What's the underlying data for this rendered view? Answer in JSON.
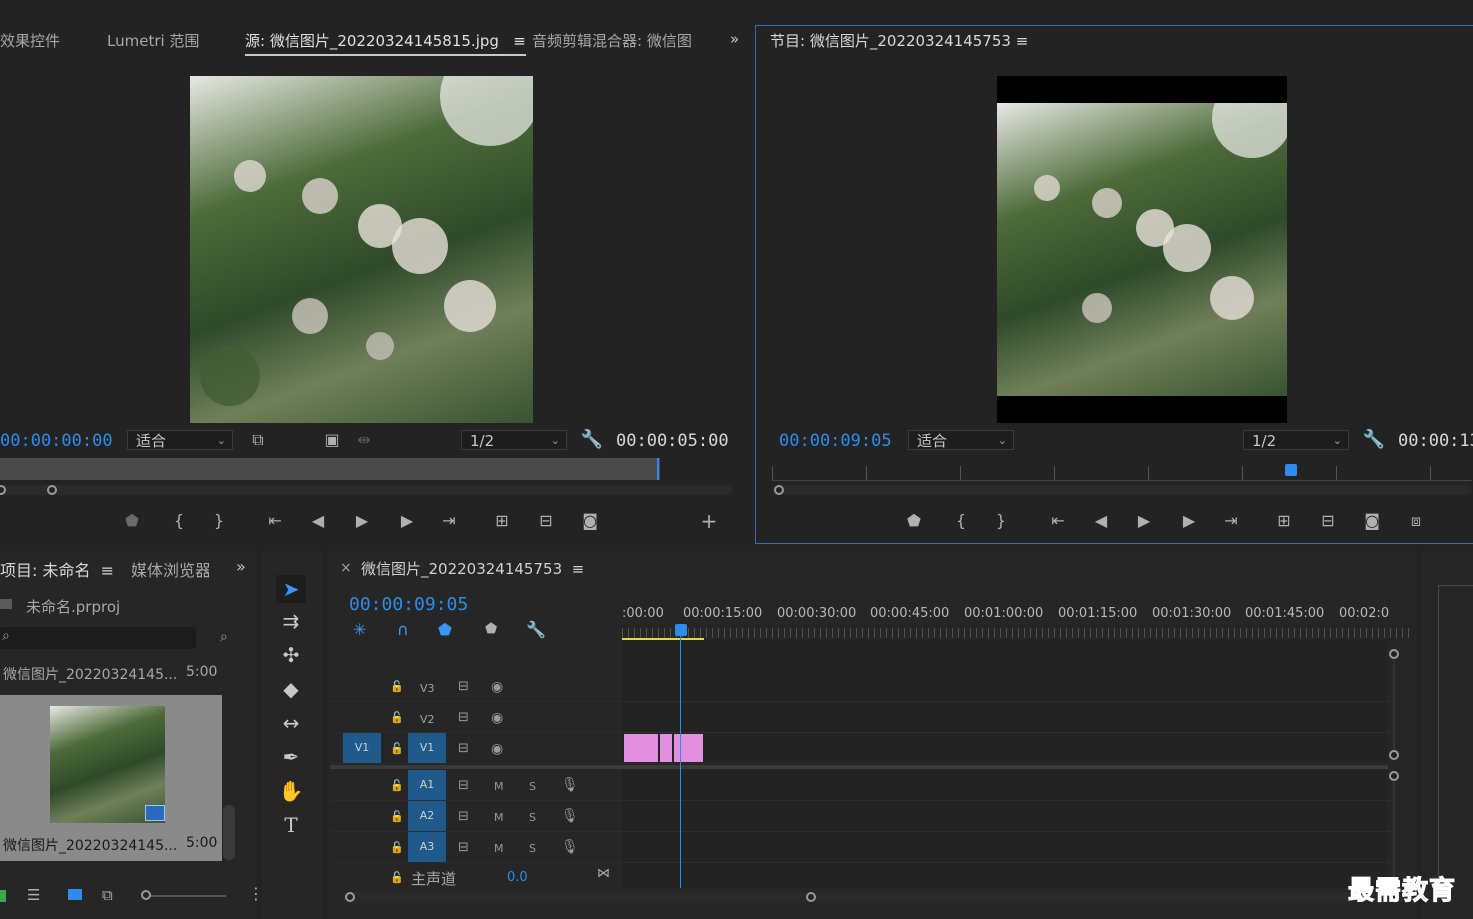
{
  "source_panel": {
    "tabs": [
      "效果控件",
      "Lumetri 范围",
      "源: 微信图片_20220324145815.jpg",
      "音频剪辑混合器: 微信图"
    ],
    "menu_icon": "≡",
    "more": "»",
    "timecode_left": "00:00:00:00",
    "fit": "适合",
    "resolution": "1/2",
    "timecode_right": "00:00:05:00"
  },
  "program_panel": {
    "title": "节目: 微信图片_20220324145753",
    "menu_icon": "≡",
    "timecode_left": "00:00:09:05",
    "fit": "适合",
    "resolution": "1/2",
    "timecode_right": "00:00:13"
  },
  "project_panel": {
    "tabs": [
      "项目: 未命名",
      "媒体浏览器"
    ],
    "menu_icon": "≡",
    "more": "»",
    "project_file": "未命名.prproj",
    "items": [
      {
        "name": "微信图片_20220324145...",
        "duration": "5:00"
      },
      {
        "name": "微信图片_20220324145...",
        "duration": "5:00"
      }
    ]
  },
  "timeline": {
    "close": "×",
    "title": "微信图片_20220324145753",
    "menu_icon": "≡",
    "timecode": "00:00:09:05",
    "ruler_labels": [
      ":00:00",
      "00:00:15:00",
      "00:00:30:00",
      "00:00:45:00",
      "00:01:00:00",
      "00:01:15:00",
      "00:01:30:00",
      "00:01:45:00",
      "00:02:0"
    ],
    "video_tracks": [
      "V3",
      "V2",
      "V1"
    ],
    "source_patch": "V1",
    "audio_tracks": [
      "A1",
      "A2",
      "A3"
    ],
    "mute": "M",
    "solo": "S",
    "master_label": "主声道",
    "master_value": "0.0"
  },
  "watermark": "最需教育",
  "colors": {
    "accent": "#2d8ceb",
    "clip": "#e28fe0",
    "track_box": "#1f5a8a"
  }
}
